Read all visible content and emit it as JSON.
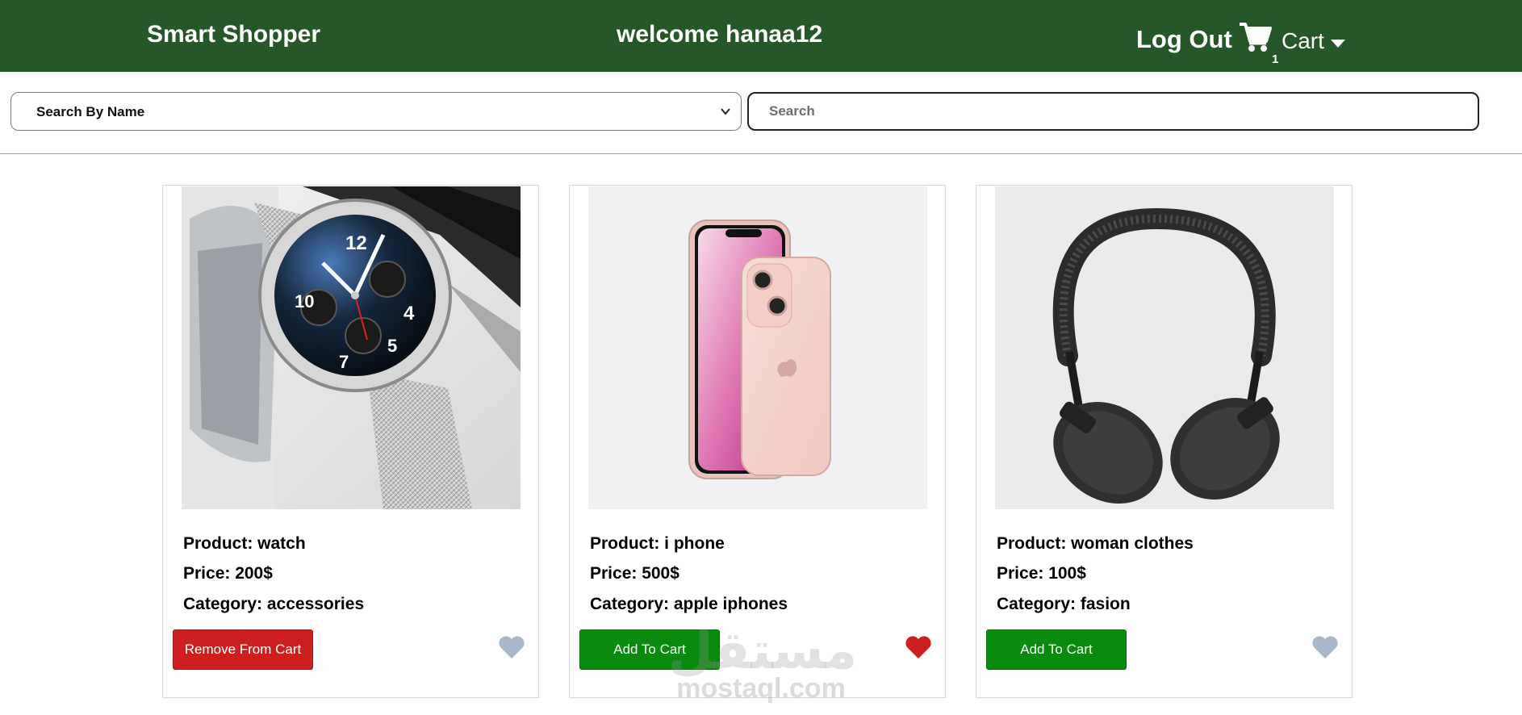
{
  "header": {
    "brand": "Smart Shopper",
    "welcome": "welcome hanaa12",
    "logout": "Log Out",
    "cart_label": "Cart",
    "cart_count": "1",
    "icons": {
      "cart": "cart-icon",
      "caret": "caret-down-icon"
    }
  },
  "search": {
    "select_value": "Search By Name",
    "placeholder": "Search"
  },
  "products": [
    {
      "name_line": "Product: watch",
      "price_line": "Price: 200$",
      "category_line": "Category: accessories",
      "button": "Remove From Cart",
      "in_cart": true,
      "favorite": false,
      "image": "watch"
    },
    {
      "name_line": "Product: i phone",
      "price_line": "Price: 500$",
      "category_line": "Category: apple iphones",
      "button": "Add To Cart",
      "in_cart": false,
      "favorite": true,
      "image": "iphone"
    },
    {
      "name_line": "Product: woman clothes",
      "price_line": "Price: 100$",
      "category_line": "Category: fasion",
      "button": "Add To Cart",
      "in_cart": false,
      "favorite": false,
      "image": "headphones"
    }
  ],
  "watermark": {
    "arabic": "مستقل",
    "latin": "mostaql.com"
  },
  "colors": {
    "header_bg": "#265728",
    "remove_button": "#cc1f1f",
    "add_button": "#0b8a10",
    "heart_active": "#cc1f1f",
    "heart_inactive": "#a8b8c8"
  }
}
